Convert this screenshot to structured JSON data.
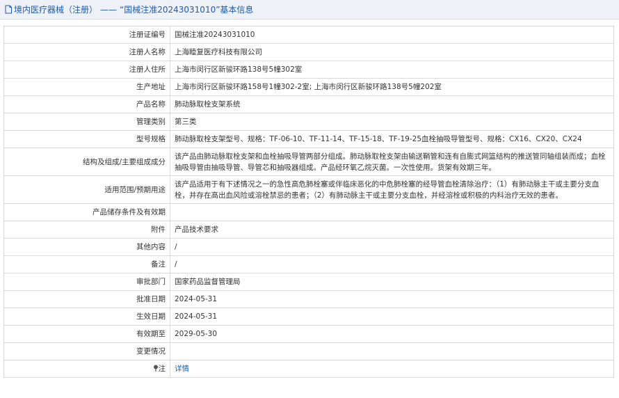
{
  "header": {
    "prefix": "境内医疗器械（注册）",
    "separator": "——",
    "title": "“国械注准20243031010”基本信息"
  },
  "rows": [
    {
      "label": "注册证编号",
      "value": "国械注准20243031010"
    },
    {
      "label": "注册人名称",
      "value": "上海睦复医疗科技有限公司"
    },
    {
      "label": "注册人住所",
      "value": "上海市闵行区新骏环路138号5幢302室"
    },
    {
      "label": "生产地址",
      "value": "上海市闵行区新骏环路158号1幢302-2室; 上海市闵行区新骏环路138号5幢202室"
    },
    {
      "label": "产品名称",
      "value": "肺动脉取栓支架系统"
    },
    {
      "label": "管理类别",
      "value": "第三类"
    },
    {
      "label": "型号规格",
      "value": "肺动脉取栓支架型号、规格：TF-06-10、TF-11-14、TF-15-18、TF-19-25血栓抽吸导管型号、规格：CX16、CX20、CX24"
    },
    {
      "label": "结构及组成/主要组成成分",
      "value": "该产品由肺动脉取栓支架和血栓抽吸导管两部分组成。肺动脉取栓支架由输送鞘管和连有自膨式网篮结构的推送管同轴组装而成；血栓抽吸导管由抽吸导管、导管芯和抽吸器组成。产品经环氧乙烷灭菌。一次性使用。货架有效期三年。"
    },
    {
      "label": "适用范围/预期用途",
      "value": "该产品适用于有下述情况之一的急性高危肺栓塞或伴临床恶化的中危肺栓塞的经导管血栓清除治疗：（1）有肺动脉主干或主要分支血栓，并存在高出血风险或溶栓禁忌的患者；（2）有肺动脉主干或主要分支血栓，并经溶栓或积极的内科治疗无效的患者。"
    },
    {
      "label": "产品储存条件及有效期",
      "value": ""
    },
    {
      "label": "附件",
      "value": "产品技术要求"
    },
    {
      "label": "其他内容",
      "value": "/"
    },
    {
      "label": "备注",
      "value": "/"
    },
    {
      "label": "审批部门",
      "value": "国家药品监督管理局"
    },
    {
      "label": "批准日期",
      "value": "2024-05-31"
    },
    {
      "label": "生效日期",
      "value": "2024-05-31"
    },
    {
      "label": "有效期至",
      "value": "2029-05-30"
    },
    {
      "label": "变更情况",
      "value": ""
    },
    {
      "label": "注",
      "value": "详情"
    }
  ]
}
